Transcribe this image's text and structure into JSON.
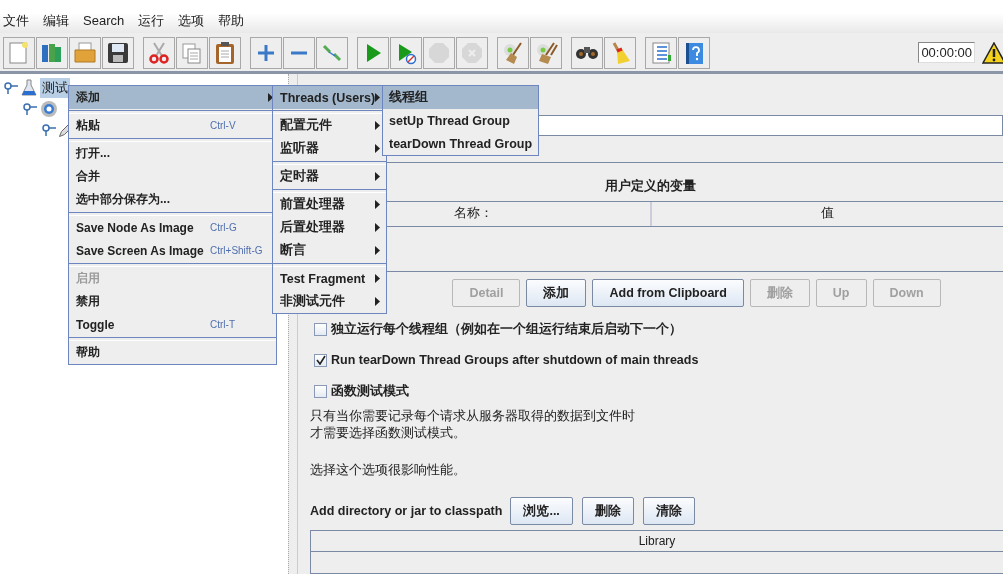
{
  "menubar": [
    "文件",
    "编辑",
    "Search",
    "运行",
    "选项",
    "帮助"
  ],
  "toolbar": {
    "groups": [
      [
        {
          "kind": "new",
          "disabled": false
        },
        {
          "kind": "templates",
          "disabled": false
        },
        {
          "kind": "open",
          "disabled": false
        },
        {
          "kind": "save",
          "disabled": false
        }
      ],
      [
        {
          "kind": "cut",
          "disabled": false
        },
        {
          "kind": "copy",
          "disabled": false
        },
        {
          "kind": "paste",
          "disabled": false
        }
      ],
      [
        {
          "kind": "expand",
          "disabled": false
        },
        {
          "kind": "collapse",
          "disabled": false
        },
        {
          "kind": "toggle",
          "disabled": false
        }
      ],
      [
        {
          "kind": "start",
          "disabled": false
        },
        {
          "kind": "start_no_timers",
          "disabled": false
        },
        {
          "kind": "stop",
          "disabled": true
        },
        {
          "kind": "shutdown",
          "disabled": true
        }
      ],
      [
        {
          "kind": "clear",
          "disabled": false
        },
        {
          "kind": "clear_all",
          "disabled": false
        }
      ],
      [
        {
          "kind": "search",
          "disabled": false
        },
        {
          "kind": "reset_search",
          "disabled": false
        }
      ],
      [
        {
          "kind": "functions",
          "disabled": false
        },
        {
          "kind": "help",
          "disabled": false
        }
      ]
    ],
    "timer": "00:00:00"
  },
  "tree": [
    {
      "kind": "plan",
      "label": "测试",
      "selected": true,
      "children": [
        {
          "kind": "threadgroup",
          "children": [
            {
              "kind": "pencil"
            }
          ]
        }
      ]
    }
  ],
  "context_menu": {
    "items": [
      {
        "kind": "item",
        "label": "添加",
        "selected": true,
        "submenu": true
      },
      {
        "kind": "separator"
      },
      {
        "kind": "item",
        "label": "粘贴",
        "shortcut": "Ctrl-V",
        "selected": false
      },
      {
        "kind": "separator"
      },
      {
        "kind": "item",
        "label": "打开...",
        "selected": false
      },
      {
        "kind": "item",
        "label": "合并",
        "selected": false
      },
      {
        "kind": "item",
        "label": "选中部分保存为...",
        "selected": false
      },
      {
        "kind": "separator"
      },
      {
        "kind": "item",
        "label": "Save Node As Image",
        "shortcut": "Ctrl-G",
        "selected": false
      },
      {
        "kind": "item",
        "label": "Save Screen As Image",
        "shortcut": "Ctrl+Shift-G",
        "selected": false
      },
      {
        "kind": "separator"
      },
      {
        "kind": "item",
        "label": "启用",
        "selected": false,
        "disabled": true
      },
      {
        "kind": "item",
        "label": "禁用",
        "selected": false
      },
      {
        "kind": "item",
        "label": "Toggle",
        "shortcut": "Ctrl-T",
        "selected": false
      },
      {
        "kind": "separator"
      },
      {
        "kind": "item",
        "label": "帮助",
        "selected": false
      }
    ]
  },
  "add_submenu": {
    "items": [
      {
        "kind": "item",
        "label": "Threads (Users)",
        "selected": true,
        "submenu": true
      },
      {
        "kind": "separator"
      },
      {
        "kind": "item",
        "label": "配置元件",
        "selected": false,
        "submenu": true
      },
      {
        "kind": "item",
        "label": "监听器",
        "selected": false,
        "submenu": true
      },
      {
        "kind": "separator"
      },
      {
        "kind": "item",
        "label": "定时器",
        "selected": false,
        "submenu": true
      },
      {
        "kind": "separator"
      },
      {
        "kind": "item",
        "label": "前置处理器",
        "selected": false,
        "submenu": true
      },
      {
        "kind": "item",
        "label": "后置处理器",
        "selected": false,
        "submenu": true
      },
      {
        "kind": "item",
        "label": "断言",
        "selected": false,
        "submenu": true
      },
      {
        "kind": "separator"
      },
      {
        "kind": "item",
        "label": "Test Fragment",
        "selected": false,
        "submenu": true
      },
      {
        "kind": "item",
        "label": "非测试元件",
        "selected": false,
        "submenu": true
      }
    ]
  },
  "threads_submenu": {
    "items": [
      {
        "kind": "item",
        "label": "线程组",
        "selected": true
      },
      {
        "kind": "item",
        "label": "setUp Thread Group",
        "selected": false
      },
      {
        "kind": "item",
        "label": "tearDown Thread Group",
        "selected": false
      }
    ]
  },
  "test_plan": {
    "variables": {
      "title": "用户定义的变量",
      "columns": [
        "名称：",
        "值"
      ]
    },
    "buttons": [
      {
        "label": "Detail",
        "disabled": true
      },
      {
        "label": "添加",
        "disabled": false
      },
      {
        "label": "Add from Clipboard",
        "disabled": false
      },
      {
        "label": "删除",
        "disabled": true
      },
      {
        "label": "Up",
        "disabled": true
      },
      {
        "label": "Down",
        "disabled": true
      }
    ],
    "options": [
      {
        "label": "独立运行每个线程组（例如在一个组运行结束后启动下一个）",
        "checked": false
      },
      {
        "label": "Run tearDown Thread Groups after shutdown of main threads",
        "checked": true
      },
      {
        "label": "函数测试模式",
        "checked": false
      }
    ],
    "notes": [
      "只有当你需要记录每个请求从服务器取得的数据到文件时",
      "才需要选择函数测试模式。",
      "选择这个选项很影响性能。"
    ],
    "classpath": {
      "label": "Add directory or jar to classpath",
      "buttons": [
        "浏览...",
        "删除",
        "清除"
      ],
      "columns": [
        "Library"
      ]
    }
  }
}
